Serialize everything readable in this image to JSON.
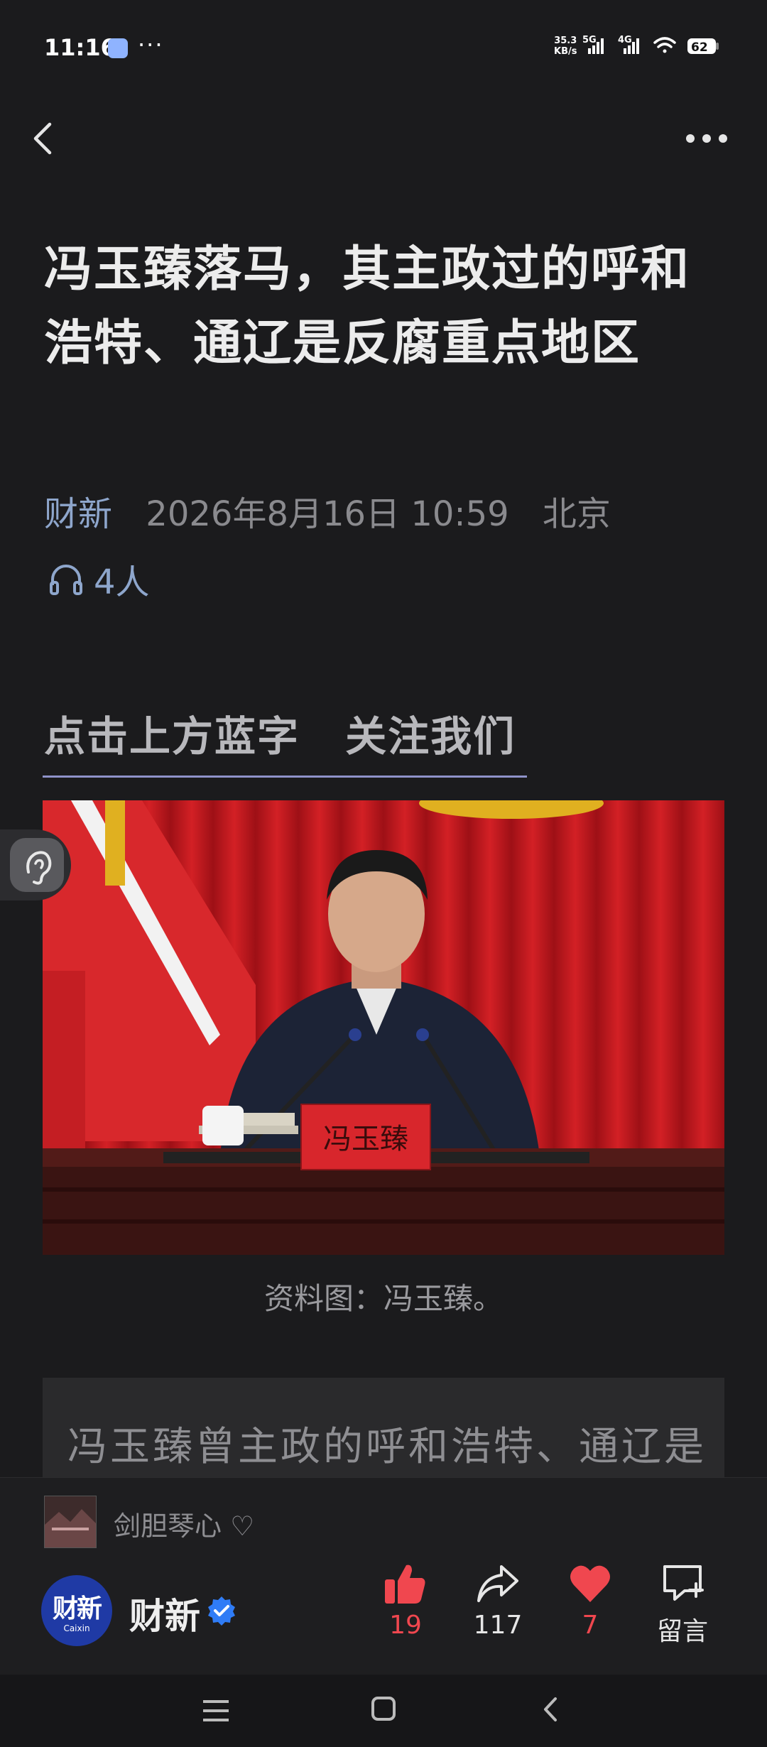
{
  "status_bar": {
    "time": "11:16",
    "more": "···",
    "net_speed": "35.3",
    "net_unit": "KB/s",
    "net_type_1": "5G",
    "net_type_2": "4G",
    "battery": "62"
  },
  "article": {
    "title": "冯玉臻落马，其主政过的呼和浩特、通辽是反腐重点地区",
    "source": "财新",
    "datetime": "2026年8月16日 10:59",
    "location": "北京",
    "listeners": "4人",
    "follow_banner_left": "点击上方蓝字",
    "follow_banner_right": "关注我们",
    "photo_nameplate": "冯玉臻",
    "photo_caption": "资料图：冯玉臻。",
    "quote_text": "冯玉臻曾主政的呼和浩特、通辽是"
  },
  "liker": {
    "text": "剑胆琴心 ♡"
  },
  "account": {
    "avatar_main": "财新",
    "avatar_sub": "Caixin",
    "name": "财新"
  },
  "actions": {
    "like_count": "19",
    "share_count": "117",
    "heart_count": "7",
    "comment_label": "留言"
  },
  "colors": {
    "background": "#1b1b1d",
    "accent_blue": "#8ea6cc",
    "like_red": "#f0474f",
    "brand_blue": "#1f3aa5"
  }
}
